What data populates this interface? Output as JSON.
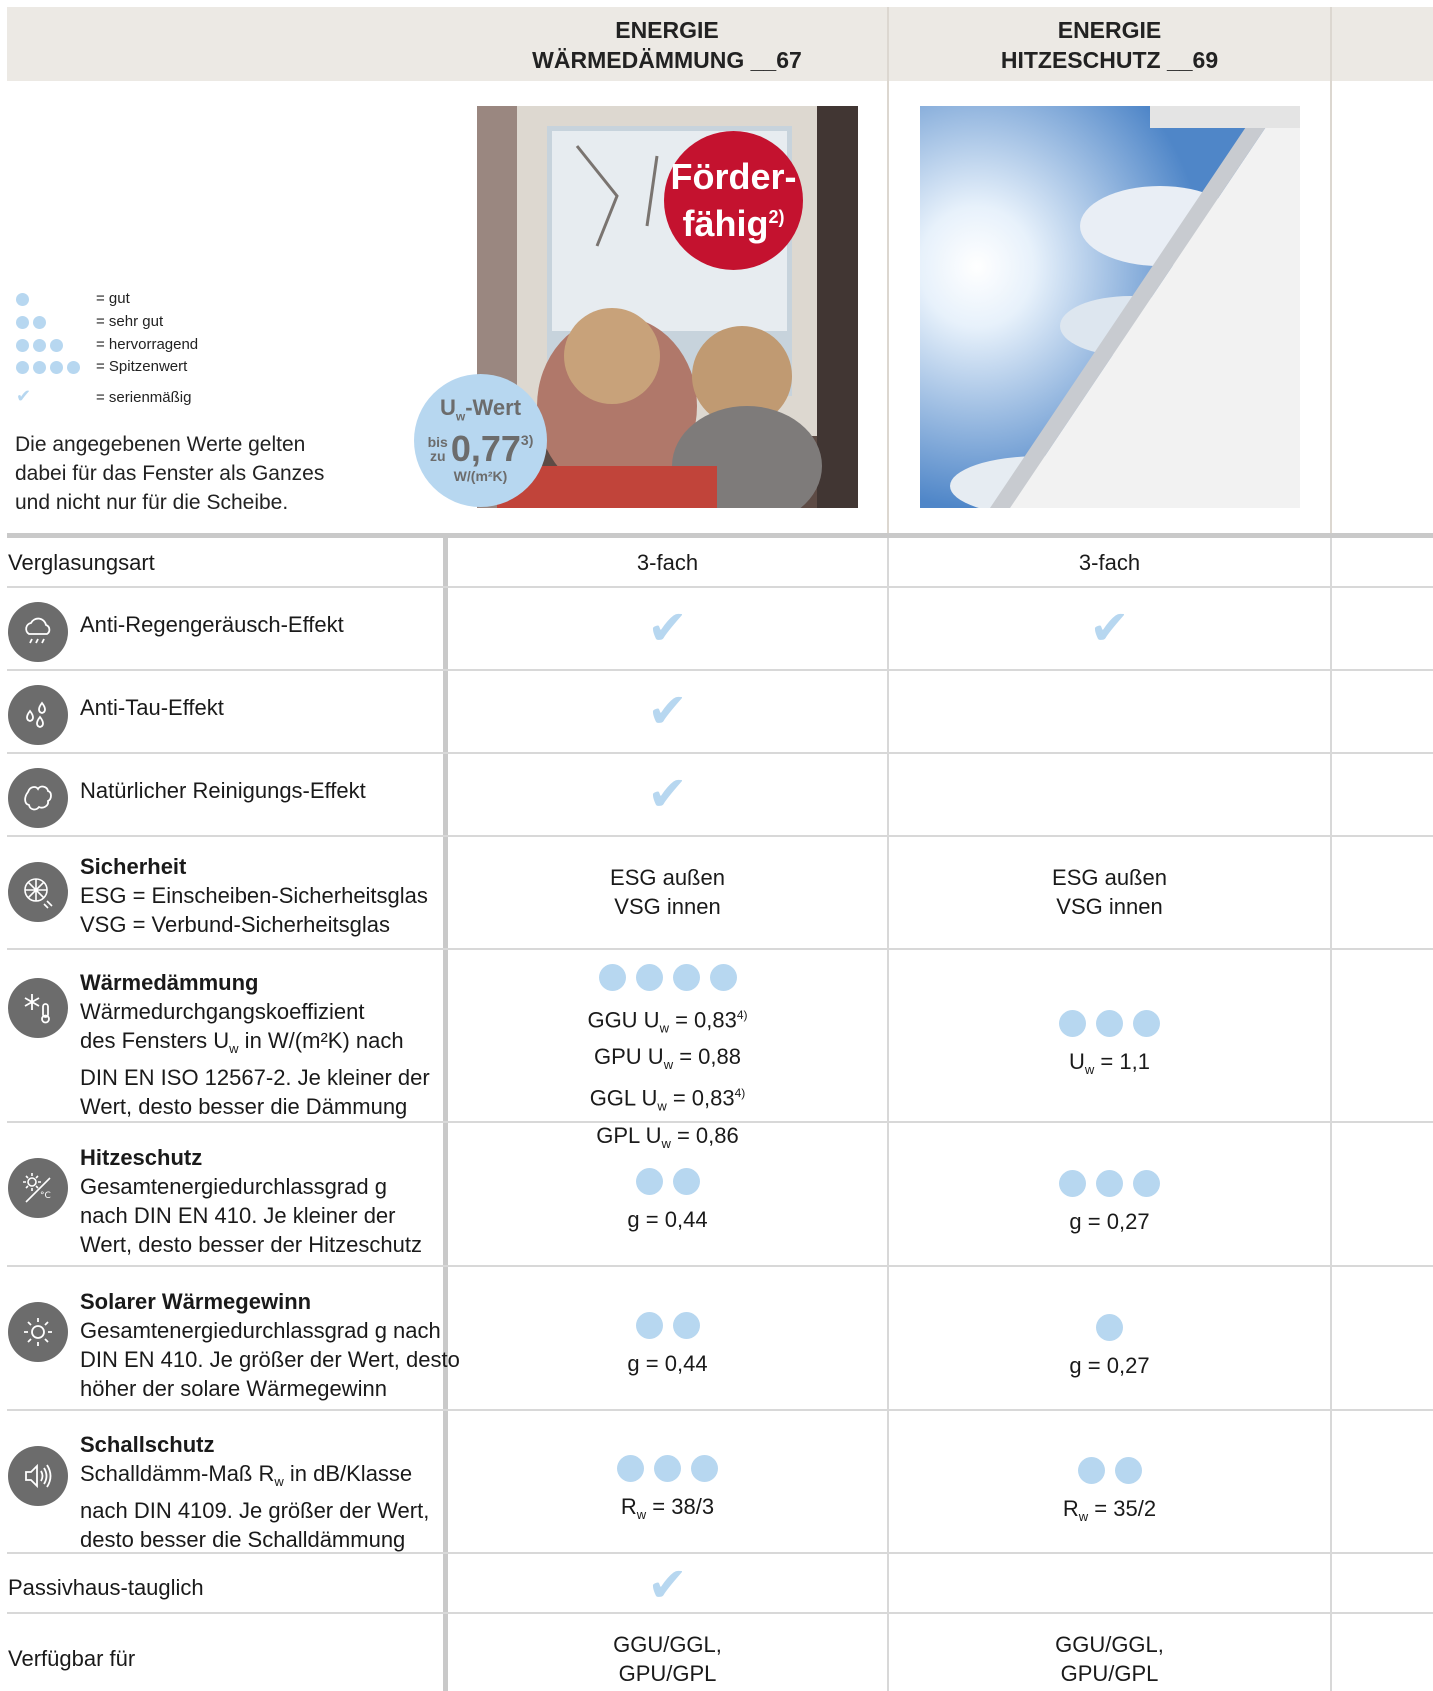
{
  "columns": [
    {
      "title1": "ENERGIE",
      "title2": "WÄRMEDÄMMUNG __67"
    },
    {
      "title1": "ENERGIE",
      "title2": "HITZESCHUTZ __69"
    }
  ],
  "legend": [
    {
      "dots": 1,
      "label": "= gut"
    },
    {
      "dots": 2,
      "label": "= sehr gut"
    },
    {
      "dots": 3,
      "label": "= hervorragend"
    },
    {
      "dots": 4,
      "label": "= Spitzenwert"
    },
    {
      "check": "✔",
      "label": "= serienmäßig"
    }
  ],
  "note": {
    "line1": "Die angegebenen Werte gelten",
    "line2": "dabei für das Fenster als Ganzes",
    "line3": "und nicht nur für die Scheibe."
  },
  "badge_red": {
    "line1": "Förder-",
    "line2": "fähig",
    "sup": "2)"
  },
  "badge_blue": {
    "title_u": "U",
    "title_w": "w",
    "title_rest": "-Wert",
    "bis": "bis",
    "zu": "zu",
    "value": "0,77",
    "sup": "3)",
    "unit": "W/(m²K)"
  },
  "rows": {
    "verglasung": {
      "label": "Verglasungsart",
      "v1": "3-fach",
      "v2": "3-fach"
    },
    "regen": {
      "label": "Anti-Regengeräusch-Effekt",
      "icon": "rain-cloud-icon",
      "v1": "✔",
      "v2": "✔"
    },
    "tau": {
      "label": "Anti-Tau-Effekt",
      "icon": "drops-icon",
      "v1": "✔"
    },
    "reinigung": {
      "label": "Natürlicher Reinigungs-Effekt",
      "icon": "cleaning-icon",
      "v1": "✔"
    },
    "sicherheit": {
      "title": "Sicherheit",
      "line1": "ESG = Einscheiben-Sicherheitsglas",
      "line2": "VSG = Verbund-Sicherheitsglas",
      "icon": "shattered-glass-icon",
      "v1a": "ESG außen",
      "v1b": "VSG innen",
      "v2a": "ESG außen",
      "v2b": "VSG innen"
    },
    "waerme": {
      "title": "Wärmedämmung",
      "line1": "Wärmedurchgangskoeffizient",
      "line2a": "des Fensters U",
      "line2b": "w",
      "line2c": " in W/(m²K) nach",
      "line3": "DIN EN ISO 12567-2. Je kleiner der",
      "line4": "Wert, desto besser die Dämmung",
      "icon": "snowflake-thermometer-icon",
      "dots1": 4,
      "dots2": 3,
      "v1": [
        {
          "pre": "GGU U",
          "val": " = 0,83",
          "sup": "4)"
        },
        {
          "pre": "GPU U",
          "val": " = 0,88",
          "sup": ""
        },
        {
          "pre": "GGL U",
          "val": " = 0,83",
          "sup": "4)"
        },
        {
          "pre": "GPL U",
          "val": " = 0,86",
          "sup": ""
        }
      ],
      "v2_pre": "U",
      "v2_val": " = 1,1",
      "sub": "w"
    },
    "hitze": {
      "title": "Hitzeschutz",
      "line1": "Gesamtenergiedurchlassgrad g",
      "line2": "nach DIN EN 410. Je kleiner der",
      "line3": "Wert, desto besser der Hitzeschutz",
      "icon": "sun-temperature-icon",
      "dots1": 2,
      "dots2": 3,
      "v1": "g = 0,44",
      "v2": "g = 0,27"
    },
    "solar": {
      "title": "Solarer Wärmegewinn",
      "line1": "Gesamtenergiedurchlassgrad g nach",
      "line2": "DIN EN 410. Je größer der Wert, desto",
      "line3": "höher der solare Wärmegewinn",
      "icon": "sun-icon",
      "dots1": 2,
      "dots2": 1,
      "v1": "g = 0,44",
      "v2": "g = 0,27"
    },
    "schall": {
      "title": "Schallschutz",
      "line1a": "Schalldämm-Maß R",
      "line1b": "w",
      "line1c": " in dB/Klasse",
      "line2": "nach DIN 4109. Je größer der Wert,",
      "line3": "desto besser die Schalldämmung",
      "icon": "speaker-icon",
      "dots1": 3,
      "dots2": 2,
      "v1_pre": "R",
      "v1_val": " = 38/3",
      "v2_pre": "R",
      "v2_val": " = 35/2",
      "sub": "w"
    },
    "passiv": {
      "label": "Passivhaus-tauglich",
      "v1": "✔"
    },
    "verfuegbar": {
      "label": "Verfügbar für",
      "v1a": "GGU/GGL,",
      "v1b": "GPU/GPL",
      "v2a": "GGU/GGL,",
      "v2b": "GPU/GPL"
    }
  },
  "colors": {
    "dot": "#b7d7f0",
    "red_badge": "#c4122f",
    "blue_badge": "#b7d7f0",
    "header_band": "#ece9e4",
    "icon_bg": "#6c6c6c"
  }
}
